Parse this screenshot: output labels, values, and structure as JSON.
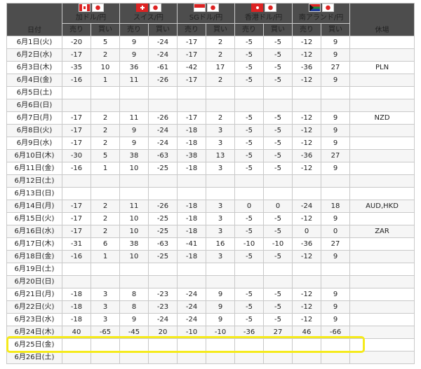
{
  "header": {
    "date_label": "日付",
    "holiday_label": "休場",
    "sell_label": "売り",
    "buy_label": "買い",
    "currencies": [
      {
        "label": "加ドル/円",
        "flag": "canada-flag-icon"
      },
      {
        "label": "スイス/円",
        "flag": "switzerland-flag-icon"
      },
      {
        "label": "SGドル/円",
        "flag": "singapore-flag-icon"
      },
      {
        "label": "香港ドル/円",
        "flag": "hongkong-flag-icon"
      },
      {
        "label": "南アランド/円",
        "flag": "southafrica-flag-icon"
      }
    ]
  },
  "rows": [
    {
      "date": "6月1日(火)",
      "values": [
        "-20",
        "5",
        "9",
        "-24",
        "-17",
        "2",
        "-5",
        "-5",
        "-12",
        "9"
      ],
      "holiday": ""
    },
    {
      "date": "6月2日(水)",
      "values": [
        "-17",
        "2",
        "9",
        "-24",
        "-17",
        "2",
        "-5",
        "-5",
        "-12",
        "9"
      ],
      "holiday": ""
    },
    {
      "date": "6月3日(木)",
      "values": [
        "-35",
        "10",
        "36",
        "-61",
        "-42",
        "17",
        "-5",
        "-5",
        "-36",
        "27"
      ],
      "holiday": "PLN"
    },
    {
      "date": "6月4日(金)",
      "values": [
        "-16",
        "1",
        "11",
        "-26",
        "-17",
        "2",
        "-5",
        "-5",
        "-12",
        "9"
      ],
      "holiday": ""
    },
    {
      "date": "6月5日(土)",
      "values": [
        "",
        "",
        "",
        "",
        "",
        "",
        "",
        "",
        "",
        ""
      ],
      "holiday": ""
    },
    {
      "date": "6月6日(日)",
      "values": [
        "",
        "",
        "",
        "",
        "",
        "",
        "",
        "",
        "",
        ""
      ],
      "holiday": ""
    },
    {
      "date": "6月7日(月)",
      "values": [
        "-17",
        "2",
        "11",
        "-26",
        "-17",
        "2",
        "-5",
        "-5",
        "-12",
        "9"
      ],
      "holiday": "NZD"
    },
    {
      "date": "6月8日(火)",
      "values": [
        "-17",
        "2",
        "9",
        "-24",
        "-18",
        "3",
        "-5",
        "-5",
        "-12",
        "9"
      ],
      "holiday": ""
    },
    {
      "date": "6月9日(水)",
      "values": [
        "-17",
        "2",
        "9",
        "-24",
        "-18",
        "3",
        "-5",
        "-5",
        "-12",
        "9"
      ],
      "holiday": ""
    },
    {
      "date": "6月10日(木)",
      "values": [
        "-30",
        "5",
        "38",
        "-63",
        "-38",
        "13",
        "-5",
        "-5",
        "-36",
        "27"
      ],
      "holiday": ""
    },
    {
      "date": "6月11日(金)",
      "values": [
        "-16",
        "1",
        "10",
        "-25",
        "-18",
        "3",
        "-5",
        "-5",
        "-12",
        "9"
      ],
      "holiday": ""
    },
    {
      "date": "6月12日(土)",
      "values": [
        "",
        "",
        "",
        "",
        "",
        "",
        "",
        "",
        "",
        ""
      ],
      "holiday": ""
    },
    {
      "date": "6月13日(日)",
      "values": [
        "",
        "",
        "",
        "",
        "",
        "",
        "",
        "",
        "",
        ""
      ],
      "holiday": ""
    },
    {
      "date": "6月14日(月)",
      "values": [
        "-17",
        "2",
        "11",
        "-26",
        "-18",
        "3",
        "0",
        "0",
        "-24",
        "18"
      ],
      "holiday": "AUD,HKD"
    },
    {
      "date": "6月15日(火)",
      "values": [
        "-17",
        "2",
        "10",
        "-25",
        "-18",
        "3",
        "-5",
        "-5",
        "-12",
        "9"
      ],
      "holiday": ""
    },
    {
      "date": "6月16日(水)",
      "values": [
        "-17",
        "2",
        "10",
        "-25",
        "-18",
        "3",
        "-5",
        "-5",
        "0",
        "0"
      ],
      "holiday": "ZAR"
    },
    {
      "date": "6月17日(木)",
      "values": [
        "-31",
        "6",
        "38",
        "-63",
        "-41",
        "16",
        "-10",
        "-10",
        "-36",
        "27"
      ],
      "holiday": ""
    },
    {
      "date": "6月18日(金)",
      "values": [
        "-16",
        "1",
        "10",
        "-25",
        "-18",
        "3",
        "-5",
        "-5",
        "-12",
        "9"
      ],
      "holiday": ""
    },
    {
      "date": "6月19日(土)",
      "values": [
        "",
        "",
        "",
        "",
        "",
        "",
        "",
        "",
        "",
        ""
      ],
      "holiday": ""
    },
    {
      "date": "6月20日(日)",
      "values": [
        "",
        "",
        "",
        "",
        "",
        "",
        "",
        "",
        "",
        ""
      ],
      "holiday": ""
    },
    {
      "date": "6月21日(月)",
      "values": [
        "-18",
        "3",
        "8",
        "-23",
        "-24",
        "9",
        "-5",
        "-5",
        "-12",
        "9"
      ],
      "holiday": ""
    },
    {
      "date": "6月22日(火)",
      "values": [
        "-18",
        "3",
        "8",
        "-23",
        "-24",
        "9",
        "-5",
        "-5",
        "-12",
        "9"
      ],
      "holiday": ""
    },
    {
      "date": "6月23日(水)",
      "values": [
        "-18",
        "3",
        "9",
        "-24",
        "-24",
        "9",
        "-5",
        "-5",
        "-12",
        "9"
      ],
      "holiday": ""
    },
    {
      "date": "6月24日(木)",
      "values": [
        "40",
        "-65",
        "-45",
        "20",
        "-10",
        "-10",
        "-36",
        "27",
        "46",
        "-66"
      ],
      "holiday": ""
    },
    {
      "date": "6月25日(金)",
      "values": [
        "",
        "",
        "",
        "",
        "",
        "",
        "",
        "",
        "",
        ""
      ],
      "holiday": ""
    },
    {
      "date": "6月26日(土)",
      "values": [
        "",
        "",
        "",
        "",
        "",
        "",
        "",
        "",
        "",
        ""
      ],
      "holiday": ""
    }
  ],
  "highlight_color": "#f5ea1b"
}
